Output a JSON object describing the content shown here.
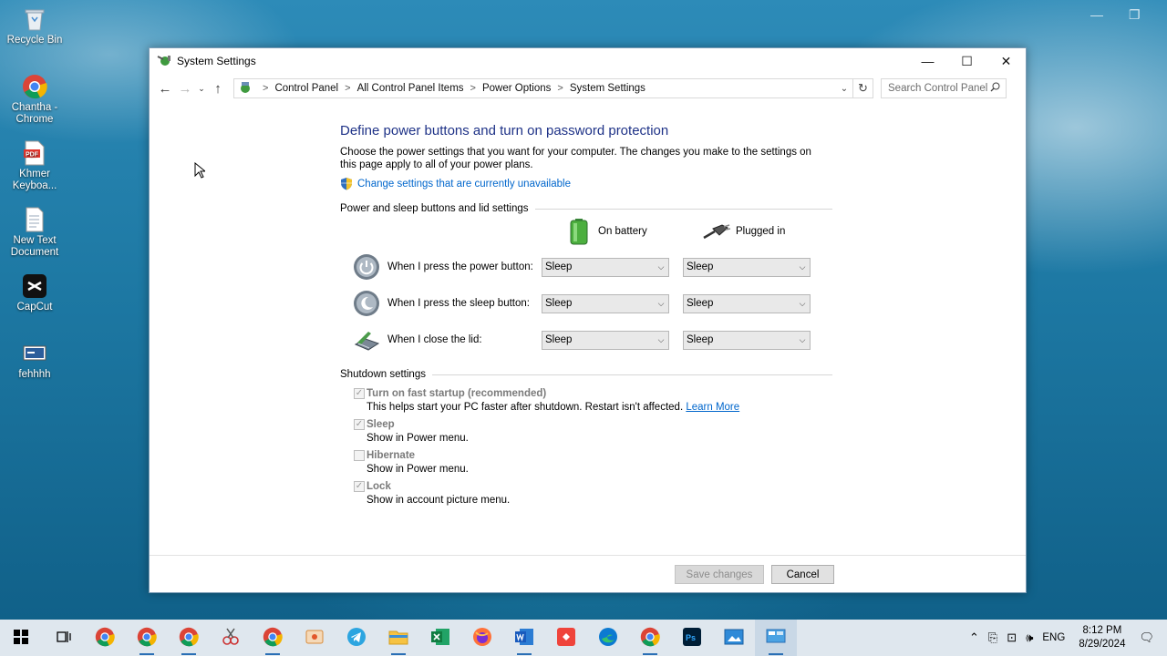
{
  "desktop": {
    "icons": [
      {
        "label": "Recycle Bin",
        "icon": "recycle-bin-icon"
      },
      {
        "label": "Chantha - Chrome",
        "icon": "chrome-icon"
      },
      {
        "label": "Khmer Keyboa...",
        "icon": "pdf-icon"
      },
      {
        "label": "New Text Document",
        "icon": "text-document-icon"
      },
      {
        "label": "CapCut",
        "icon": "capcut-icon"
      },
      {
        "label": "fehhhh",
        "icon": "shortcut-icon"
      }
    ]
  },
  "window": {
    "title": "System Settings",
    "breadcrumb": [
      "Control Panel",
      "All Control Panel Items",
      "Power Options",
      "System Settings"
    ],
    "search_placeholder": "Search Control Panel",
    "heading": "Define power buttons and turn on password protection",
    "description": "Choose the power settings that you want for your computer. The changes you make to the settings on this page apply to all of your power plans.",
    "change_link": "Change settings that are currently unavailable",
    "buttons_section": "Power and sleep buttons and lid settings",
    "col_battery": "On battery",
    "col_plugged": "Plugged in",
    "rows": [
      {
        "label": "When I press the power button:",
        "battery": "Sleep",
        "plugged": "Sleep"
      },
      {
        "label": "When I press the sleep button:",
        "battery": "Sleep",
        "plugged": "Sleep"
      },
      {
        "label": "When I close the lid:",
        "battery": "Sleep",
        "plugged": "Sleep"
      }
    ],
    "shutdown_section": "Shutdown settings",
    "shutdown_items": [
      {
        "title": "Turn on fast startup (recommended)",
        "desc": "This helps start your PC faster after shutdown. Restart isn't affected.",
        "link": "Learn More",
        "checked": true
      },
      {
        "title": "Sleep",
        "desc": "Show in Power menu.",
        "checked": true
      },
      {
        "title": "Hibernate",
        "desc": "Show in Power menu.",
        "checked": false
      },
      {
        "title": "Lock",
        "desc": "Show in account picture menu.",
        "checked": true
      }
    ],
    "save_label": "Save changes",
    "cancel_label": "Cancel"
  },
  "taskbar": {
    "language": "ENG",
    "time": "8:12 PM",
    "date": "8/29/2024"
  }
}
